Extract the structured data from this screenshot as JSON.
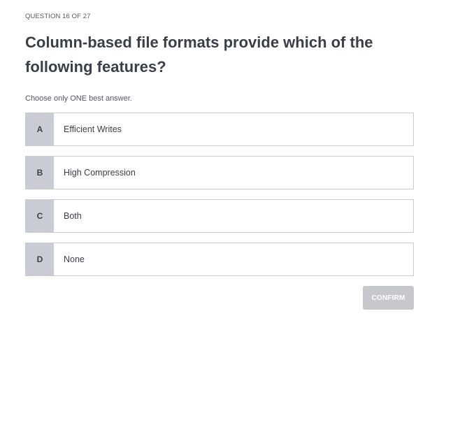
{
  "header": {
    "progress": "QUESTION 16 OF 27"
  },
  "question": {
    "title": "Column-based file formats provide which of the following features?",
    "instruction": "Choose only ONE best answer."
  },
  "options": [
    {
      "letter": "A",
      "text": "Efficient Writes"
    },
    {
      "letter": "B",
      "text": "High Compression"
    },
    {
      "letter": "C",
      "text": "Both"
    },
    {
      "letter": "D",
      "text": "None"
    }
  ],
  "actions": {
    "confirm_label": "CONFIRM",
    "confirm_enabled": false
  },
  "colors": {
    "letter_bg": "#c9ccd4",
    "option_border": "#cacbcc",
    "confirm_disabled_bg": "#c6c8cc",
    "text": "#3a3f47"
  }
}
